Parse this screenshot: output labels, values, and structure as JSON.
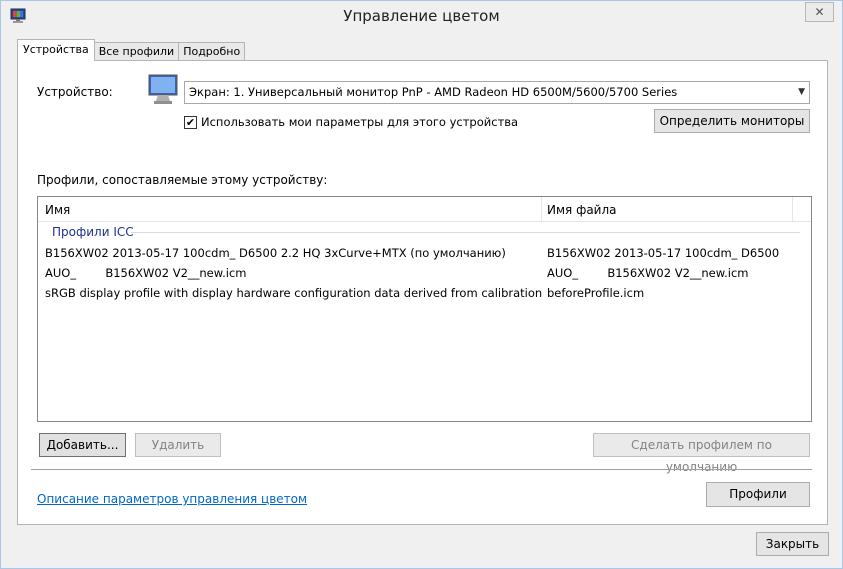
{
  "window": {
    "title": "Управление цветом",
    "close_glyph": "✕"
  },
  "tabs": [
    {
      "label": "Устройства",
      "active": true
    },
    {
      "label": "Все профили",
      "active": false
    },
    {
      "label": "Подробно",
      "active": false
    }
  ],
  "device": {
    "label": "Устройство:",
    "icon": "monitor-icon",
    "selected": "Экран: 1. Универсальный монитор PnP - AMD Radeon HD 6500M/5600/5700 Series",
    "use_my_settings_label": "Использовать мои параметры для этого устройства",
    "use_my_settings_checked": true,
    "identify_button": "Определить мониторы"
  },
  "profiles": {
    "label": "Профили, сопоставляемые этому устройству:",
    "columns": [
      "Имя",
      "Имя файла"
    ],
    "group": "Профили ICC",
    "rows": [
      {
        "name": "B156XW02 2013-05-17 100cdm_ D6500 2.2 HQ 3xCurve+MTX (по умолчанию)",
        "file": "B156XW02 2013-05-17 100cdm_ D6500 2.2 ..."
      },
      {
        "name": "AUO_        B156XW02 V2__new.icm",
        "file": "AUO_        B156XW02 V2__new.icm"
      },
      {
        "name": "sRGB display profile with display hardware configuration data derived from calibration",
        "file": "beforeProfile.icm"
      }
    ]
  },
  "buttons": {
    "add": "Добавить...",
    "remove": "Удалить",
    "set_default": "Сделать профилем по умолчанию",
    "profiles": "Профили",
    "close": "Закрыть"
  },
  "link": "Описание параметров управления цветом",
  "colors": {
    "accent": "#0066cc",
    "group_header": "#1e3287"
  }
}
